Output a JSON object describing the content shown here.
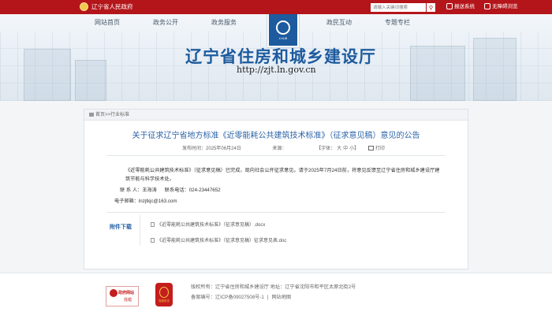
{
  "top_bar": {
    "gov_name": "辽宁省人民政府",
    "search_placeholder": "请输入关键词搜索",
    "search_icon": "search-icon",
    "links": [
      "报送系统",
      "无障碍浏览"
    ]
  },
  "nav": {
    "items": [
      "网站首页",
      "政务公开",
      "政务服务",
      "政民互动",
      "专题专栏"
    ],
    "logo_label": "LHUB"
  },
  "banner": {
    "title": "辽宁省住房和城乡建设厅",
    "url": "http://zjt.ln.gov.cn"
  },
  "breadcrumb": {
    "home": "首页",
    "separator": ">>",
    "current": "行业标准"
  },
  "article": {
    "title": "关于征求辽宁省地方标准《近零能耗公共建筑技术标准》（征求意见稿）意见的公告",
    "publish_label": "发布时间：",
    "publish_date": "2025年06月24日",
    "source_label": "来源：",
    "font_size_label": "【字体：",
    "font_large": "大",
    "font_medium": "中",
    "font_small": "小",
    "font_close": "】",
    "print_label": "打印",
    "paragraph": "《近零能耗公共建筑技术标准》（征求意见稿）已完成，现向社会公开征求意见。请于2025年7月24日前，将意见反馈至辽宁省住房和城乡建设厅建筑节能与科学技术处。",
    "contact_person": "联 系 人：王海涛",
    "contact_phone": "联系电话：024-23447652",
    "email": "电子邮箱：lnzjtkjc@163.com"
  },
  "attachments": {
    "label": "附件下载",
    "files": [
      "《近零能耗公共建筑技术标准》（征求意见稿）.docx",
      "《近零能耗公共建筑技术标准》（征求意见稿）征求意见表.doc"
    ]
  },
  "footer": {
    "badge1_title": "政府网站",
    "badge1_sub": "找错",
    "badge2_label": "党政机关",
    "sponsor": "版权所有：辽宁省住房和城乡建设厅 地址：辽宁省沈阳市和平区太原北街2号",
    "icp": "备案编号：辽ICP备09027508号-1",
    "separator": "|",
    "sitemap": "网站地图"
  }
}
